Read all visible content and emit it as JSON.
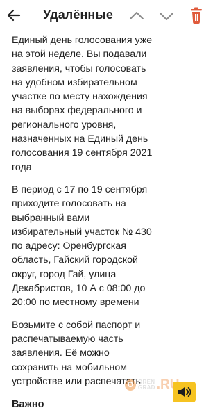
{
  "header": {
    "title": "Удалённые",
    "back_icon": "arrow-left-icon",
    "up_icon": "chevron-up-icon",
    "down_icon": "chevron-down-icon",
    "delete_icon": "trash-icon",
    "delete_icon_color": "#e05a3b"
  },
  "message": {
    "paragraphs": [
      {
        "lines": [
          "Единый день голосования уже",
          "на этой неделе. Вы подавали",
          "заявления, чтобы голосовать",
          "на удобном избирательном",
          "участке по месту нахождения",
          "на выборах федерального и",
          "регионального уровня,",
          "назначенных на Единый день",
          "голосования 19 сентября 2021",
          "года"
        ]
      },
      {
        "lines": [
          "В период с 17 по 19 сентября",
          "приходите голосовать на",
          "выбранный вами",
          "избирательный участок № 430",
          "по адресу: Оренбургская",
          "область, Гайский городской",
          "округ, город Гай, улица",
          "Декабристов, 10 А с 08:00 до",
          "20:00 по местному времени"
        ]
      },
      {
        "lines": [
          "Возьмите с собой паспорт и",
          "распечатываемую часть",
          "заявления. Её можно",
          "сохранить на мобильном",
          "устройстве или распечатать"
        ]
      }
    ],
    "important_heading": "Важно"
  },
  "watermark": {
    "logo_letter": "О",
    "line1": "OREN",
    "line2": "GRAD",
    "suffix": ".RU",
    "accent": "#f29a4c"
  },
  "speaker_button": {
    "icon": "speaker-icon",
    "color": "#f6c321"
  }
}
